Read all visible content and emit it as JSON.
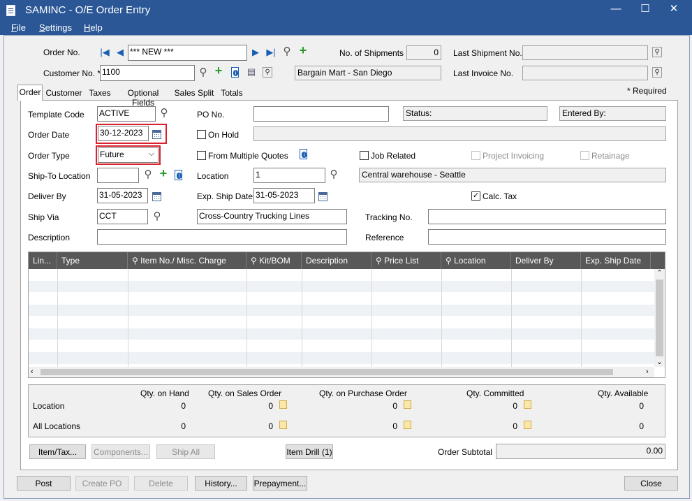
{
  "window": {
    "title": "SAMINC - O/E Order Entry",
    "minimize": "—",
    "maximize": "☐",
    "close": "✕"
  },
  "menu": {
    "file": "File",
    "settings": "Settings",
    "help": "Help"
  },
  "header": {
    "order_no_label": "Order No.",
    "order_no_value": "*** NEW ***",
    "shipments_label": "No. of Shipments",
    "shipments_value": "0",
    "last_shipment_label": "Last Shipment No.",
    "customer_no_label": "Customer No. *",
    "customer_no_value": "1100",
    "customer_name": "Bargain Mart - San Diego",
    "last_invoice_label": "Last Invoice No.",
    "required_note": "*  Required"
  },
  "tabs": [
    "Order",
    "Customer",
    "Taxes",
    "Optional Fields",
    "Sales Split",
    "Totals"
  ],
  "order": {
    "template_code_label": "Template Code",
    "template_code_value": "ACTIVE",
    "po_no_label": "PO No.",
    "status_label": "Status:",
    "entered_by_label": "Entered By:",
    "order_date_label": "Order Date",
    "order_date_value": "30-12-2023",
    "on_hold_label": "On Hold",
    "order_type_label": "Order Type",
    "order_type_value": "Future",
    "from_quotes_label": "From Multiple Quotes",
    "job_related_label": "Job Related",
    "project_invoicing_label": "Project Invoicing",
    "retainage_label": "Retainage",
    "ship_to_label": "Ship-To Location",
    "location_label": "Location",
    "location_value": "1",
    "location_desc": "Central warehouse - Seattle",
    "deliver_by_label": "Deliver By",
    "deliver_by_value": "31-05-2023",
    "exp_ship_label": "Exp. Ship Date",
    "exp_ship_value": "31-05-2023",
    "calc_tax_label": "Calc. Tax",
    "ship_via_label": "Ship Via",
    "ship_via_value": "CCT",
    "ship_via_desc": "Cross-Country Trucking Lines",
    "tracking_label": "Tracking No.",
    "description_label": "Description",
    "reference_label": "Reference"
  },
  "grid": {
    "columns": [
      "Lin...",
      "Type",
      "Item No./ Misc. Charge",
      "Kit/BOM",
      "Description",
      "Price List",
      "Location",
      "Deliver By",
      "Exp. Ship Date"
    ]
  },
  "summary": {
    "headers": [
      "Qty. on Hand",
      "Qty. on Sales Order",
      "Qty. on Purchase Order",
      "Qty. Committed",
      "Qty. Available"
    ],
    "rows": [
      {
        "label": "Location",
        "values": [
          "0",
          "0",
          "0",
          "0",
          "0"
        ]
      },
      {
        "label": "All Locations",
        "values": [
          "0",
          "0",
          "0",
          "0",
          "0"
        ]
      }
    ]
  },
  "actions": {
    "item_tax": "Item/Tax...",
    "components": "Components...",
    "ship_all": "Ship All",
    "item_drill": "Item Drill (1)",
    "order_subtotal_label": "Order Subtotal",
    "order_subtotal_value": "0.00"
  },
  "footer": {
    "post": "Post",
    "create_po": "Create PO",
    "delete": "Delete",
    "history": "History...",
    "prepayment": "Prepayment...",
    "close": "Close"
  }
}
